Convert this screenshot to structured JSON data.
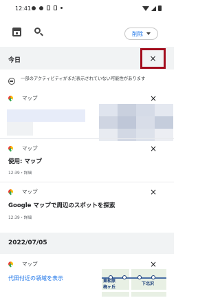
{
  "status_bar": {
    "time": "12:41"
  },
  "header": {
    "delete_menu_label": "削除"
  },
  "sections": {
    "today": {
      "title": "今日"
    },
    "dated": {
      "title": "2022/07/05"
    }
  },
  "notice": {
    "text": "一部のアクティビティがまだ表示されていない可能性があります"
  },
  "cards": [
    {
      "app_name": "マップ",
      "image": "blurred-thumbnail"
    },
    {
      "app_name": "マップ",
      "title": "使用: マップ",
      "meta": "12:39・詳細"
    },
    {
      "app_name": "マップ",
      "title": "Google マップで周辺のスポットを探索",
      "meta": "12:39・詳細"
    },
    {
      "app_name": "マップ",
      "link": "代田付近の領域を表示",
      "map_labels": [
        "東松原",
        "梅ヶ丘",
        "下北沢"
      ]
    }
  ],
  "colors": {
    "accent_blue": "#1a73e8",
    "highlight_red": "#a30d1d",
    "section_bg": "#f1f3f4"
  },
  "icons": {
    "close": "×"
  }
}
